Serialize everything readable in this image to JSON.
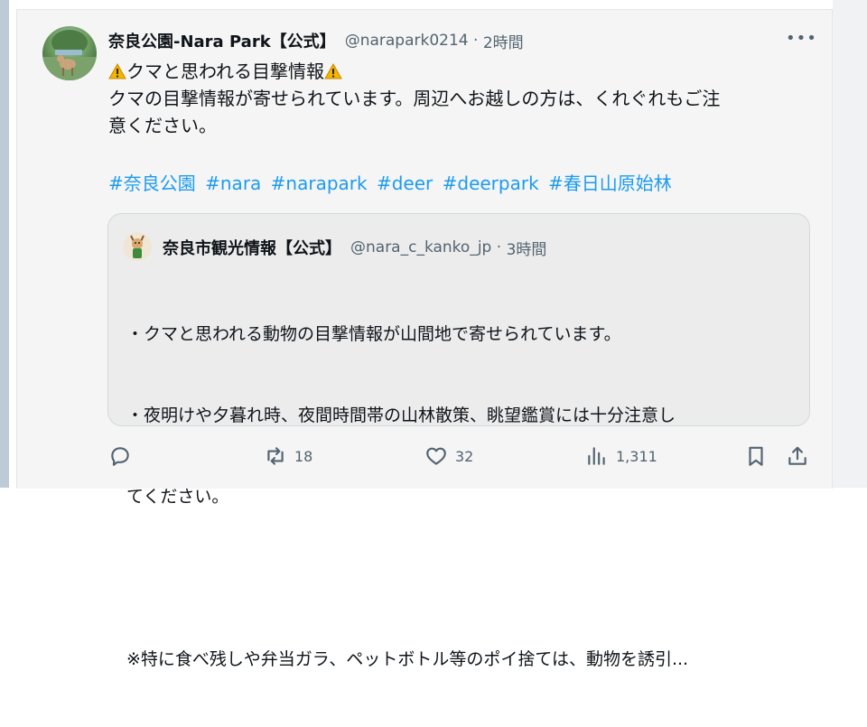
{
  "post": {
    "author_name": "奈良公園-Nara Park【公式】",
    "author_handle": "@narapark0214",
    "time": "2時間",
    "more": "•••",
    "title_line": "クマと思われる目撃情報",
    "body_lines": [
      "クマの目撃情報が寄せられています。周辺へお越しの方は、くれぐれもご注",
      "意ください。"
    ],
    "hashtags": [
      "#奈良公園",
      "#nara",
      "#narapark",
      "#deer",
      "#deerpark",
      "#春日山原始林"
    ]
  },
  "quote": {
    "author_name": "奈良市観光情報【公式】",
    "author_handle": "@nara_c_kanko_jp",
    "time": "3時間",
    "lines": [
      "・クマと思われる動物の目撃情報が山間地で寄せられています。",
      "・夜明けや夕暮れ時、夜間時間帯の山林散策、眺望鑑賞には十分注意し",
      "てください。",
      "",
      "※特に食べ残しや弁当ガラ、ペットボトル等のポイ捨ては、動物を誘引..."
    ]
  },
  "actions": {
    "reply_count": "",
    "repost_count": "18",
    "like_count": "32",
    "view_count": "1,311"
  },
  "colors": {
    "hashtag": "#1d9bf0",
    "secondary_text": "#536471",
    "warning": "#f4b400"
  },
  "icons": [
    "warning-icon",
    "more-icon",
    "reply-icon",
    "repost-icon",
    "like-icon",
    "views-icon",
    "bookmark-icon",
    "share-icon"
  ]
}
